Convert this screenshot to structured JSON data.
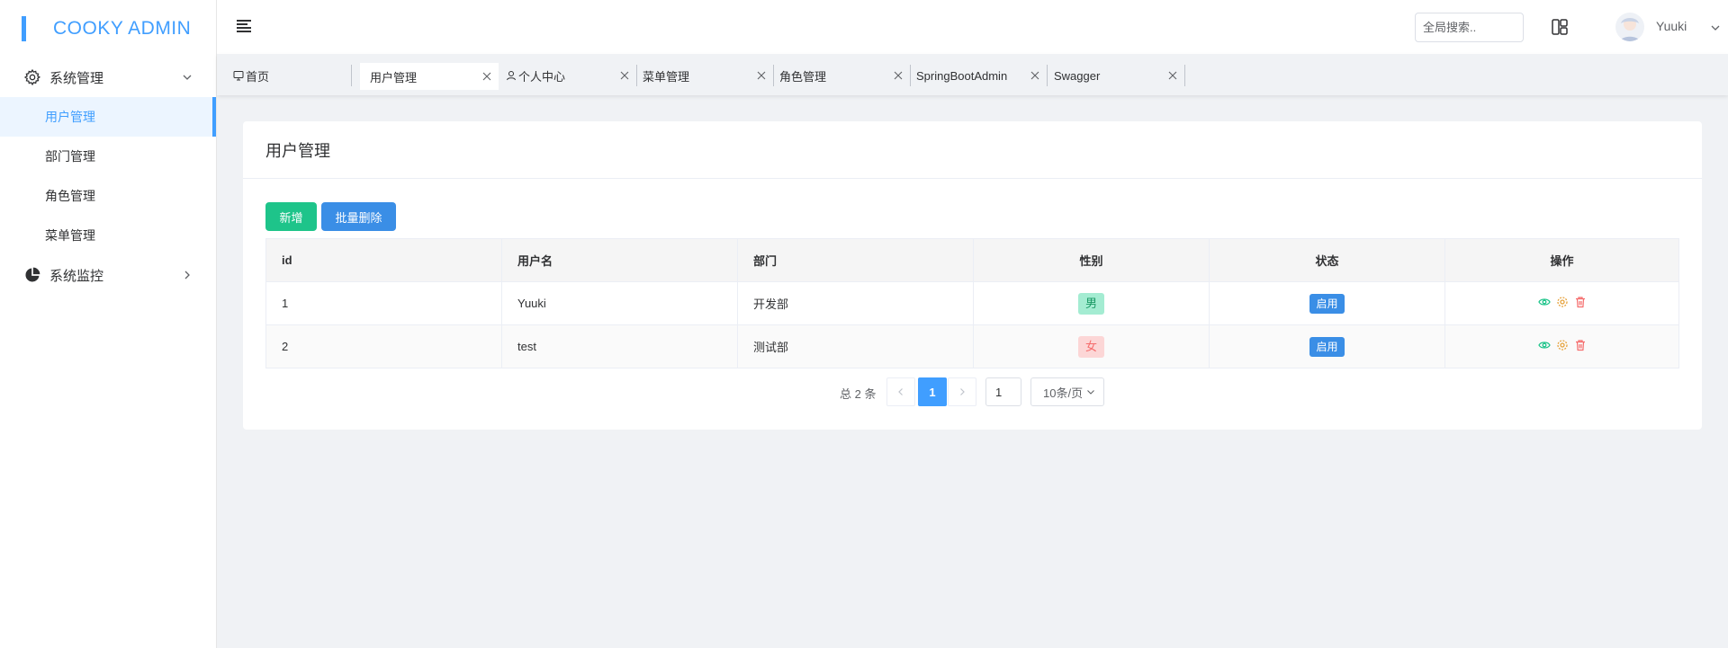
{
  "app": {
    "title": "COOKY ADMIN",
    "accent": "#409eff"
  },
  "sidebar": {
    "groups": [
      {
        "label": "系统管理",
        "icon": "gear-icon",
        "expanded": true
      },
      {
        "label": "系统监控",
        "icon": "pie-chart-icon",
        "expanded": false
      }
    ],
    "items": [
      {
        "label": "用户管理",
        "active": true
      },
      {
        "label": "部门管理"
      },
      {
        "label": "角色管理"
      },
      {
        "label": "菜单管理"
      }
    ]
  },
  "header": {
    "search_placeholder": "全局搜索..",
    "username": "Yuuki"
  },
  "tabs": [
    {
      "label": "首页",
      "icon": "monitor-icon"
    },
    {
      "label": "用户管理",
      "active": true
    },
    {
      "label": "个人中心",
      "icon": "user-icon"
    },
    {
      "label": "菜单管理"
    },
    {
      "label": "角色管理"
    },
    {
      "label": "SpringBootAdmin"
    },
    {
      "label": "Swagger"
    }
  ],
  "card": {
    "title": "用户管理",
    "add_label": "新增",
    "batch_delete_label": "批量删除"
  },
  "table": {
    "columns": [
      "id",
      "用户名",
      "部门",
      "性别",
      "状态",
      "操作"
    ],
    "rows": [
      {
        "id": "1",
        "username": "Yuuki",
        "dept": "开发部",
        "gender": "男",
        "status": "启用"
      },
      {
        "id": "2",
        "username": "test",
        "dept": "测试部",
        "gender": "女",
        "status": "启用"
      }
    ]
  },
  "pagination": {
    "total_text": "总 2 条",
    "current_page": "1",
    "jump_value": "1",
    "page_size": "10条/页"
  }
}
